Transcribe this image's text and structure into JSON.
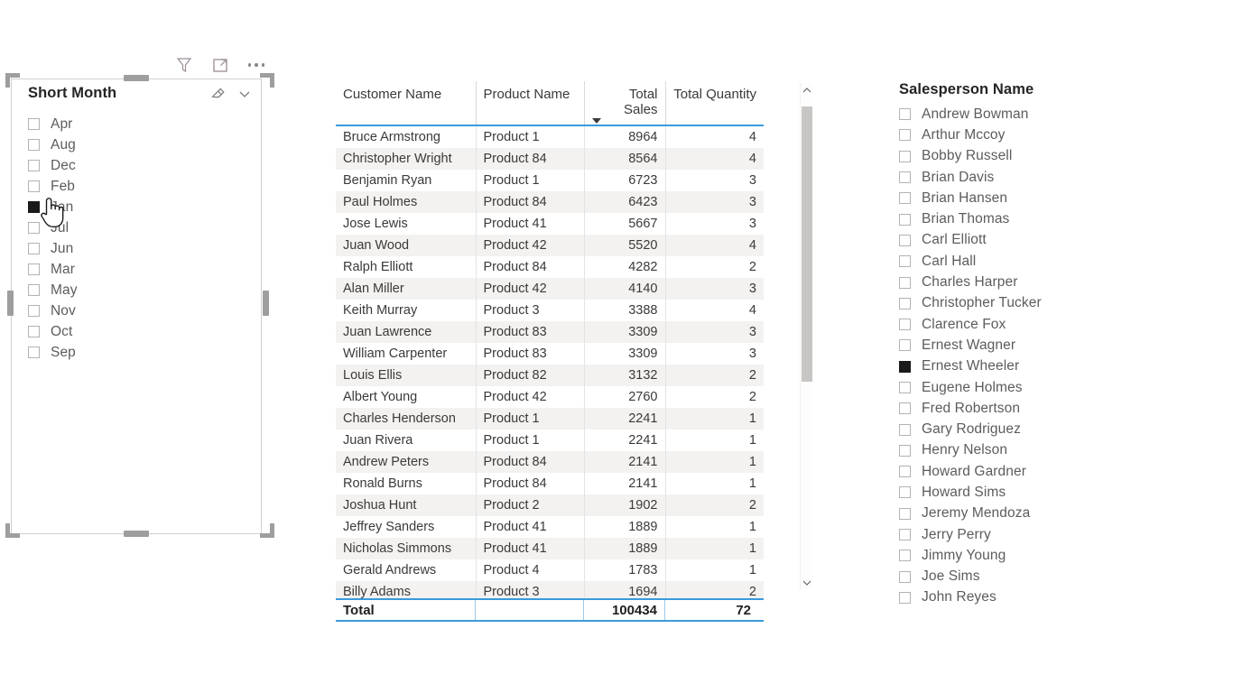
{
  "visual_header": {
    "icons": [
      {
        "name": "filter-icon",
        "label": "Filters"
      },
      {
        "name": "focus-mode-icon",
        "label": "Focus mode"
      },
      {
        "name": "more-options-icon",
        "label": "More options"
      }
    ]
  },
  "slicer": {
    "title": "Short Month",
    "clear_icon": "eraser-icon",
    "expand_icon": "chevron-down-icon",
    "items": [
      {
        "label": "Apr",
        "checked": false
      },
      {
        "label": "Aug",
        "checked": false
      },
      {
        "label": "Dec",
        "checked": false
      },
      {
        "label": "Feb",
        "checked": false
      },
      {
        "label": "Jan",
        "checked": true
      },
      {
        "label": "Jul",
        "checked": false
      },
      {
        "label": "Jun",
        "checked": false
      },
      {
        "label": "Mar",
        "checked": false
      },
      {
        "label": "May",
        "checked": false
      },
      {
        "label": "Nov",
        "checked": false
      },
      {
        "label": "Oct",
        "checked": false
      },
      {
        "label": "Sep",
        "checked": false
      }
    ]
  },
  "table": {
    "columns": [
      {
        "label": "Customer Name",
        "align": "left"
      },
      {
        "label": "Product Name",
        "align": "left"
      },
      {
        "label": "Total Sales",
        "align": "right",
        "sorted": "desc"
      },
      {
        "label": "Total Quantity",
        "align": "right"
      }
    ],
    "rows": [
      [
        "Bruce Armstrong",
        "Product 1",
        "8964",
        "4"
      ],
      [
        "Christopher Wright",
        "Product 84",
        "8564",
        "4"
      ],
      [
        "Benjamin Ryan",
        "Product 1",
        "6723",
        "3"
      ],
      [
        "Paul Holmes",
        "Product 84",
        "6423",
        "3"
      ],
      [
        "Jose Lewis",
        "Product 41",
        "5667",
        "3"
      ],
      [
        "Juan Wood",
        "Product 42",
        "5520",
        "4"
      ],
      [
        "Ralph Elliott",
        "Product 84",
        "4282",
        "2"
      ],
      [
        "Alan Miller",
        "Product 42",
        "4140",
        "3"
      ],
      [
        "Keith Murray",
        "Product 3",
        "3388",
        "4"
      ],
      [
        "Juan Lawrence",
        "Product 83",
        "3309",
        "3"
      ],
      [
        "William Carpenter",
        "Product 83",
        "3309",
        "3"
      ],
      [
        "Louis Ellis",
        "Product 82",
        "3132",
        "2"
      ],
      [
        "Albert Young",
        "Product 42",
        "2760",
        "2"
      ],
      [
        "Charles Henderson",
        "Product 1",
        "2241",
        "1"
      ],
      [
        "Juan Rivera",
        "Product 1",
        "2241",
        "1"
      ],
      [
        "Andrew Peters",
        "Product 84",
        "2141",
        "1"
      ],
      [
        "Ronald Burns",
        "Product 84",
        "2141",
        "1"
      ],
      [
        "Joshua Hunt",
        "Product 2",
        "1902",
        "2"
      ],
      [
        "Jeffrey Sanders",
        "Product 41",
        "1889",
        "1"
      ],
      [
        "Nicholas Simmons",
        "Product 41",
        "1889",
        "1"
      ],
      [
        "Gerald Andrews",
        "Product 4",
        "1783",
        "1"
      ],
      [
        "Billy Adams",
        "Product 3",
        "1694",
        "2"
      ]
    ],
    "total": {
      "label": "Total",
      "product": "",
      "total_sales": "100434",
      "total_quantity": "72"
    }
  },
  "scrollbar": {
    "up_icon": "chevron-up-icon",
    "down_icon": "chevron-down-icon"
  },
  "salesperson": {
    "title": "Salesperson Name",
    "items": [
      {
        "label": "Andrew Bowman",
        "checked": false
      },
      {
        "label": "Arthur Mccoy",
        "checked": false
      },
      {
        "label": "Bobby Russell",
        "checked": false
      },
      {
        "label": "Brian Davis",
        "checked": false
      },
      {
        "label": "Brian Hansen",
        "checked": false
      },
      {
        "label": "Brian Thomas",
        "checked": false
      },
      {
        "label": "Carl Elliott",
        "checked": false
      },
      {
        "label": "Carl Hall",
        "checked": false
      },
      {
        "label": "Charles Harper",
        "checked": false
      },
      {
        "label": "Christopher Tucker",
        "checked": false
      },
      {
        "label": "Clarence Fox",
        "checked": false
      },
      {
        "label": "Ernest Wagner",
        "checked": false
      },
      {
        "label": "Ernest Wheeler",
        "checked": true
      },
      {
        "label": "Eugene Holmes",
        "checked": false
      },
      {
        "label": "Fred Robertson",
        "checked": false
      },
      {
        "label": "Gary Rodriguez",
        "checked": false
      },
      {
        "label": "Henry Nelson",
        "checked": false
      },
      {
        "label": "Howard Gardner",
        "checked": false
      },
      {
        "label": "Howard Sims",
        "checked": false
      },
      {
        "label": "Jeremy Mendoza",
        "checked": false
      },
      {
        "label": "Jerry Perry",
        "checked": false
      },
      {
        "label": "Jimmy Young",
        "checked": false
      },
      {
        "label": "Joe Sims",
        "checked": false
      },
      {
        "label": "John Reyes",
        "checked": false
      }
    ]
  },
  "cursor": {
    "name": "hand-pointer-cursor"
  },
  "colors": {
    "accent_blue": "#3a9bdc",
    "alt_row": "#f3f2f1",
    "checkbox_checked": "#1a1a1a",
    "text": "#3b3a39",
    "muted_text": "#5c5c5c",
    "handle": "#9e9e9e"
  }
}
